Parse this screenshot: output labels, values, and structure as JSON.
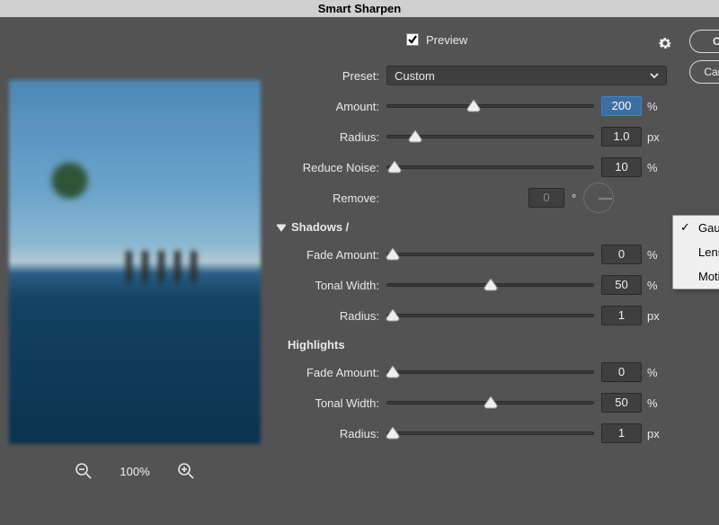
{
  "title": "Smart Sharpen",
  "preview": {
    "label": "Preview",
    "checked": true
  },
  "buttons": {
    "ok": "OK",
    "cancel": "Cancel"
  },
  "preset": {
    "label": "Preset:",
    "value": "Custom"
  },
  "sliders": {
    "amount": {
      "label": "Amount:",
      "value": "200",
      "unit": "%",
      "pos": 42,
      "highlight": true
    },
    "radius": {
      "label": "Radius:",
      "value": "1.0",
      "unit": "px",
      "pos": 14
    },
    "reduceNoise": {
      "label": "Reduce Noise:",
      "value": "10",
      "unit": "%",
      "pos": 4
    }
  },
  "remove": {
    "label": "Remove:",
    "angle_value": "0",
    "angle_unit": "°",
    "options": [
      "Gaussian Blur",
      "Lens Blur",
      "Motion Blur"
    ],
    "selected": "Gaussian Blur"
  },
  "sections": {
    "shadows": {
      "title": "Shadows /",
      "fadeAmount": {
        "label": "Fade Amount:",
        "value": "0",
        "unit": "%",
        "pos": 3
      },
      "tonalWidth": {
        "label": "Tonal Width:",
        "value": "50",
        "unit": "%",
        "pos": 50
      },
      "radius": {
        "label": "Radius:",
        "value": "1",
        "unit": "px",
        "pos": 3
      }
    },
    "highlights": {
      "title": "Highlights",
      "fadeAmount": {
        "label": "Fade Amount:",
        "value": "0",
        "unit": "%",
        "pos": 3
      },
      "tonalWidth": {
        "label": "Tonal Width:",
        "value": "50",
        "unit": "%",
        "pos": 50
      },
      "radius": {
        "label": "Radius:",
        "value": "1",
        "unit": "px",
        "pos": 3
      }
    }
  },
  "zoom": {
    "level": "100%"
  }
}
